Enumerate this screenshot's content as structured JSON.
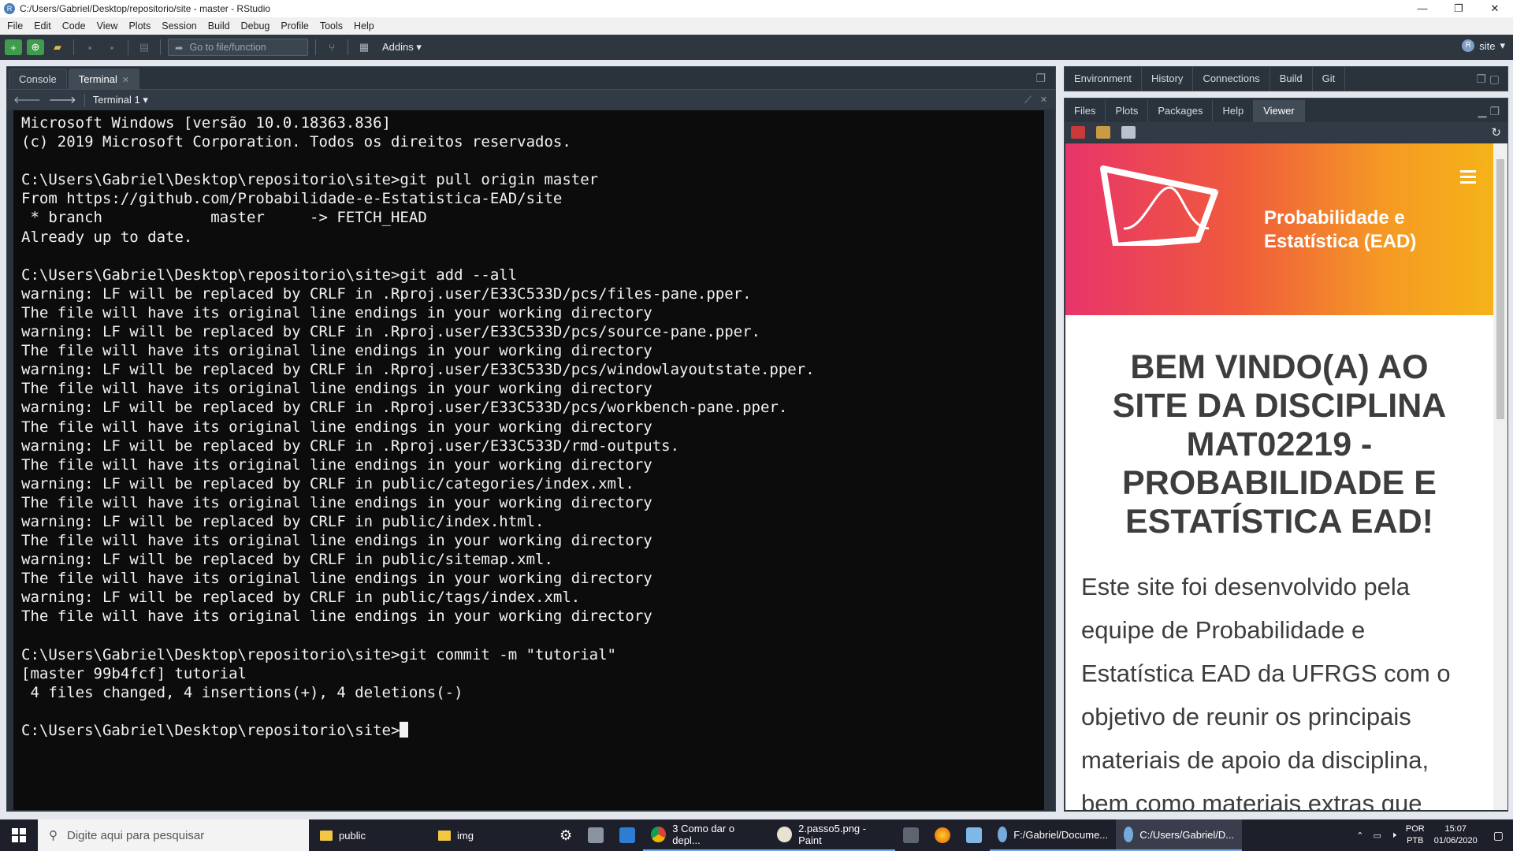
{
  "window": {
    "title": "C:/Users/Gabriel/Desktop/repositorio/site - master - RStudio",
    "app_icon": "R",
    "minimize": "—",
    "maximize": "❐",
    "close": "✕"
  },
  "menu": [
    "File",
    "Edit",
    "Code",
    "View",
    "Plots",
    "Session",
    "Build",
    "Debug",
    "Profile",
    "Tools",
    "Help"
  ],
  "toolbar": {
    "goto_placeholder": "Go to file/function",
    "addins_label": "Addins",
    "project_label": "site"
  },
  "left_pane": {
    "tabs": [
      {
        "label": "Console"
      },
      {
        "label": "Terminal"
      }
    ],
    "terminal_selector": "Terminal 1",
    "terminal_lines": [
      "Microsoft Windows [versão 10.0.18363.836]",
      "(c) 2019 Microsoft Corporation. Todos os direitos reservados.",
      "",
      "C:\\Users\\Gabriel\\Desktop\\repositorio\\site>git pull origin master",
      "From https://github.com/Probabilidade-e-Estatistica-EAD/site",
      " * branch            master     -> FETCH_HEAD",
      "Already up to date.",
      "",
      "C:\\Users\\Gabriel\\Desktop\\repositorio\\site>git add --all",
      "warning: LF will be replaced by CRLF in .Rproj.user/E33C533D/pcs/files-pane.pper.",
      "The file will have its original line endings in your working directory",
      "warning: LF will be replaced by CRLF in .Rproj.user/E33C533D/pcs/source-pane.pper.",
      "The file will have its original line endings in your working directory",
      "warning: LF will be replaced by CRLF in .Rproj.user/E33C533D/pcs/windowlayoutstate.pper.",
      "The file will have its original line endings in your working directory",
      "warning: LF will be replaced by CRLF in .Rproj.user/E33C533D/pcs/workbench-pane.pper.",
      "The file will have its original line endings in your working directory",
      "warning: LF will be replaced by CRLF in .Rproj.user/E33C533D/rmd-outputs.",
      "The file will have its original line endings in your working directory",
      "warning: LF will be replaced by CRLF in public/categories/index.xml.",
      "The file will have its original line endings in your working directory",
      "warning: LF will be replaced by CRLF in public/index.html.",
      "The file will have its original line endings in your working directory",
      "warning: LF will be replaced by CRLF in public/sitemap.xml.",
      "The file will have its original line endings in your working directory",
      "warning: LF will be replaced by CRLF in public/tags/index.xml.",
      "The file will have its original line endings in your working directory",
      "",
      "C:\\Users\\Gabriel\\Desktop\\repositorio\\site>git commit -m \"tutorial\"",
      "[master 99b4fcf] tutorial",
      " 4 files changed, 4 insertions(+), 4 deletions(-)",
      ""
    ],
    "prompt": "C:\\Users\\Gabriel\\Desktop\\repositorio\\site>"
  },
  "right_top": {
    "tabs": [
      "Environment",
      "History",
      "Connections",
      "Build",
      "Git"
    ]
  },
  "right_bottom": {
    "tabs": [
      "Files",
      "Plots",
      "Packages",
      "Help",
      "Viewer"
    ],
    "active_tab": "Viewer",
    "site": {
      "brand_line1": "Probabilidade e",
      "brand_line2": "Estatística (EAD)",
      "welcome": "BEM VINDO(A) AO SITE DA DISCIPLINA MAT02219 - PROBABILIDADE E ESTATÍSTICA EAD!",
      "intro": "Este site foi desenvolvido pela equipe de Probabilidade e Estatística EAD da UFRGS com o objetivo de reunir os principais materiais de apoio da disciplina, bem como materiais extras que",
      "banner_colors": [
        "#e8346a",
        "#f5b318"
      ]
    }
  },
  "taskbar": {
    "search_placeholder": "Digite aqui para pesquisar",
    "items": [
      {
        "label": "public",
        "icon": "folder-icon"
      },
      {
        "label": "img",
        "icon": "folder-icon"
      },
      {
        "label": "3 Como dar o depl...",
        "icon": "chrome-icon"
      },
      {
        "label": "2.passo5.png - Paint",
        "icon": "paint-icon"
      },
      {
        "label": "F:/Gabriel/Docume...",
        "icon": "rstudio-icon"
      },
      {
        "label": "C:/Users/Gabriel/D...",
        "icon": "rstudio-icon"
      }
    ],
    "lang": "POR",
    "lang_sub": "PTB",
    "time": "15:07",
    "date": "01/06/2020"
  }
}
